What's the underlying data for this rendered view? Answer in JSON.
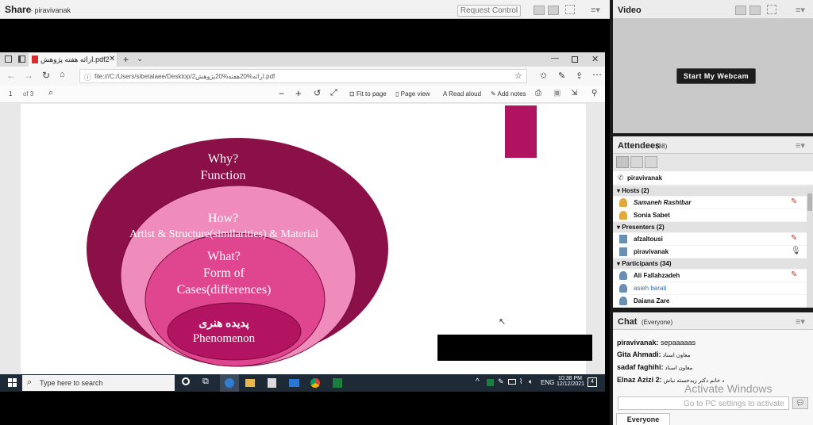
{
  "share": {
    "title": "Share",
    "owner": "piravivanak",
    "request_control": "Request Control",
    "menu": "≡▾"
  },
  "browser": {
    "tab_title": "ارائه هفته پژوهش.pdf2",
    "url": "file:///C:/Users/sibetalaee/Desktop/2ارائه%20هفته%20پژوهش.pdf",
    "page_current": "1",
    "page_total": "of 3",
    "fit_to_page": "Fit to page",
    "page_view": "Page view",
    "read_aloud": "Read aloud",
    "add_notes": "Add notes"
  },
  "slide": {
    "outer_line1": "Why?",
    "outer_line2": "Function",
    "second_line1": "How?",
    "second_line2": "Artist & Structure(similarities) & Material",
    "third_line1": "What?",
    "third_line2": "Form of",
    "third_line3": "Cases(differences)",
    "inner_line1": "پدیده هنری",
    "inner_line2": "Phenomenon",
    "colors": {
      "outer": "#8b1048",
      "second": "#f08cbc",
      "third": "#e0458f",
      "inner": "#b21462",
      "swatch": "#b01461"
    }
  },
  "taskbar": {
    "search_placeholder": "Type here to search",
    "lang": "ENG",
    "time": "10:38 PM",
    "date": "12/12/2021",
    "notif_count": "4"
  },
  "video": {
    "title": "Video",
    "webcam_button": "Start My Webcam"
  },
  "attendees": {
    "title": "Attendees",
    "count": "(38)",
    "me": "piravivanak",
    "hosts_label": "Hosts (2)",
    "hosts": [
      "Samaneh Rashtbar",
      "Sonia Sabet"
    ],
    "presenters_label": "Presenters (2)",
    "presenters": [
      "afzaltousi",
      "piravivanak"
    ],
    "participants_label": "Participants (34)",
    "participants": [
      "Ali Fallahzadeh",
      "asieh barati",
      "Daiana Zare"
    ]
  },
  "chat": {
    "title": "Chat",
    "scope": "(Everyone)",
    "messages": [
      {
        "name": "piravivanak:",
        "text": " sepaaaaas"
      },
      {
        "name": "Gita Ahmadi:",
        "text": " معاون استاد"
      },
      {
        "name": "sadaf faghihi:",
        "text": " معاون استاد"
      },
      {
        "name": "Elnaz Azizi 2:",
        "text": " د خانم دکتر زیدخسته نباش"
      }
    ],
    "watermark1": "Activate Windows",
    "watermark2": "Go to PC settings to activate",
    "footer_tab": "Everyone"
  }
}
